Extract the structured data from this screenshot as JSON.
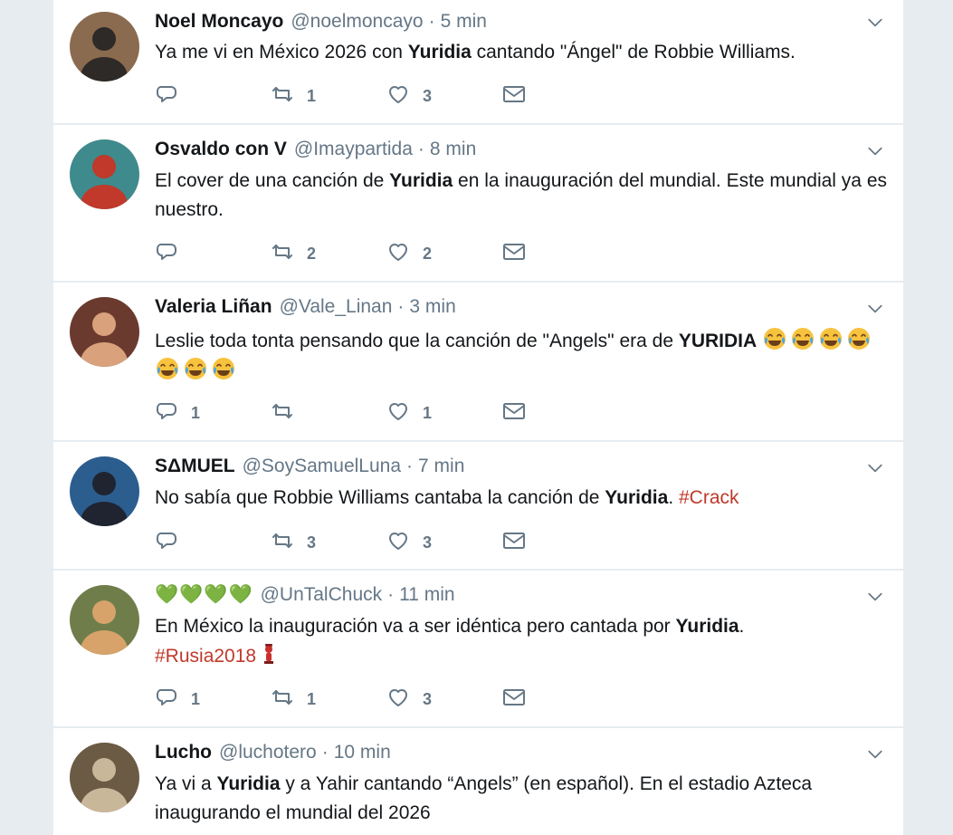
{
  "colors": {
    "hashtag": "#c0392b",
    "muted": "#657786",
    "heart_green": "#69b33b"
  },
  "tweets": [
    {
      "name": "Noel Moncayo",
      "handle": "@noelmoncayo",
      "time": "5 min",
      "parts": [
        {
          "t": "Ya me vi en México 2026 con "
        },
        {
          "b": "Yuridia"
        },
        {
          "t": " cantando \"Ángel\" de Robbie Williams."
        }
      ],
      "replies": "",
      "retweets": "1",
      "likes": "3"
    },
    {
      "name": "Osvaldo con V",
      "handle": "@Imaypartida",
      "time": "8 min",
      "parts": [
        {
          "t": "El cover de una canción de "
        },
        {
          "b": "Yuridia"
        },
        {
          "t": " en la inauguración del mundial. Este mundial ya es nuestro."
        }
      ],
      "replies": "",
      "retweets": "2",
      "likes": "2"
    },
    {
      "name": "Valeria Liñan",
      "handle": "@Vale_Linan",
      "time": "3 min",
      "parts": [
        {
          "t": "Leslie toda tonta pensando que la canción  de \"Angels\" era de "
        },
        {
          "b": "YURIDIA"
        },
        {
          "t": " "
        },
        {
          "e": "joy-emoji"
        },
        {
          "e": "joy-emoji"
        },
        {
          "e": "joy-emoji"
        },
        {
          "e": "joy-emoji"
        },
        {
          "e": "joy-emoji"
        },
        {
          "e": "joy-emoji"
        },
        {
          "e": "joy-emoji"
        }
      ],
      "replies": "1",
      "retweets": "",
      "likes": "1"
    },
    {
      "name": "SΔMUEL",
      "handle": "@SoySamuelLuna",
      "time": "7 min",
      "parts": [
        {
          "t": "No sabía que Robbie Williams cantaba la canción de "
        },
        {
          "b": "Yuridia"
        },
        {
          "t": ". "
        },
        {
          "h": "#Crack"
        }
      ],
      "replies": "",
      "retweets": "3",
      "likes": "3"
    },
    {
      "name": "💚💚💚💚",
      "handle": "@UnTalChuck",
      "time": "11 min",
      "parts": [
        {
          "t": "En México la inauguración va a ser idéntica pero cantada por "
        },
        {
          "b": "Yuridia"
        },
        {
          "t": "."
        },
        {
          "br": true
        },
        {
          "h": "#Rusia2018"
        },
        {
          "e": "cup-emoji"
        }
      ],
      "replies": "1",
      "retweets": "1",
      "likes": "3"
    },
    {
      "name": "Lucho",
      "handle": "@luchotero",
      "time": "10 min",
      "parts": [
        {
          "t": "Ya vi a "
        },
        {
          "b": "Yuridia"
        },
        {
          "t": " y a Yahir cantando “Angels” (en español). En el estadio Azteca inaugurando el mundial del 2026"
        }
      ],
      "replies": "",
      "retweets": "",
      "likes": ""
    }
  ]
}
